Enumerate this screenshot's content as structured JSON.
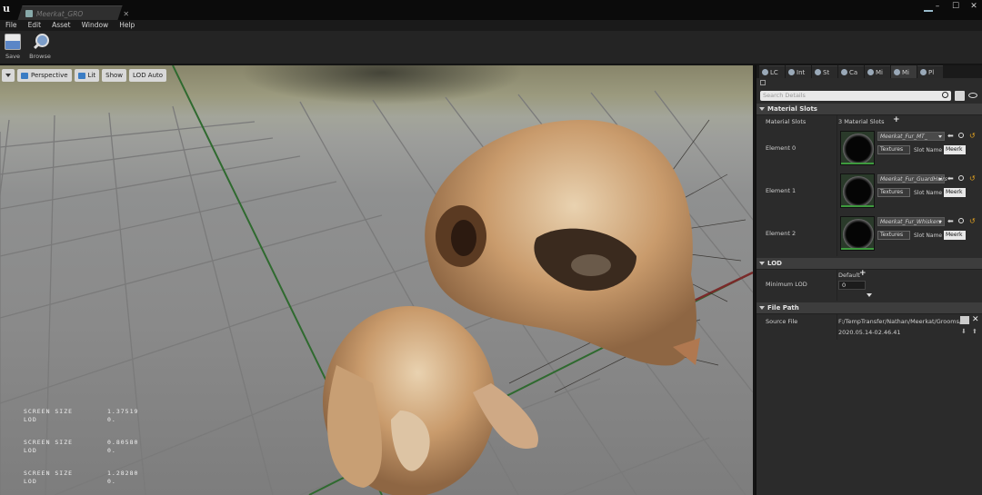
{
  "window": {
    "tab_title": "Meerkat_GRO",
    "controls": [
      "–",
      "☐",
      "✕"
    ]
  },
  "menu": [
    "File",
    "Edit",
    "Asset",
    "Window",
    "Help"
  ],
  "toolbar": {
    "save_label": "Save",
    "browse_label": "Browse"
  },
  "viewport": {
    "buttons": {
      "perspective": "Perspective",
      "lit": "Lit",
      "show": "Show",
      "lod": "LOD Auto"
    },
    "stats": [
      {
        "k1": "SCREEN SIZE",
        "v1": "1.37519",
        "k2": "LOD",
        "v2": "0."
      },
      {
        "k1": "SCREEN SIZE",
        "v1": "0.80580",
        "k2": "LOD",
        "v2": "0."
      },
      {
        "k1": "SCREEN SIZE",
        "v1": "1.28280",
        "k2": "LOD",
        "v2": "0."
      }
    ]
  },
  "details": {
    "tabs": [
      "LC",
      "Int",
      "St",
      "Ca",
      "Mi",
      "Mi",
      "Pl"
    ],
    "search_placeholder": "Search Details",
    "material_section": "Material Slots",
    "material_slots_label": "Material Slots",
    "material_slots_value": "3 Material Slots",
    "elements": [
      {
        "name": "Element 0",
        "material": "Meerkat_Fur_MT_",
        "textures": "Textures",
        "slot_name_label": "Slot Name",
        "slot_name": "Meerk"
      },
      {
        "name": "Element 1",
        "material": "Meerkat_Fur_GuardHairs",
        "textures": "Textures",
        "slot_name_label": "Slot Name",
        "slot_name": "Meerk"
      },
      {
        "name": "Element 2",
        "material": "Meerkat_Fur_Whiskers",
        "textures": "Textures",
        "slot_name_label": "Slot Name",
        "slot_name": "Meerk"
      }
    ],
    "lod_section": "LOD",
    "minimum_lod_label": "Minimum LOD",
    "default_label": "Default",
    "minimum_lod_value": "0",
    "filepath_section": "File Path",
    "source_file_label": "Source File",
    "source_file_path": "F:/TempTransfer/Nathan/Meerkat/Grooms/V",
    "source_file_date": "2020.05.14-02.46.41"
  }
}
